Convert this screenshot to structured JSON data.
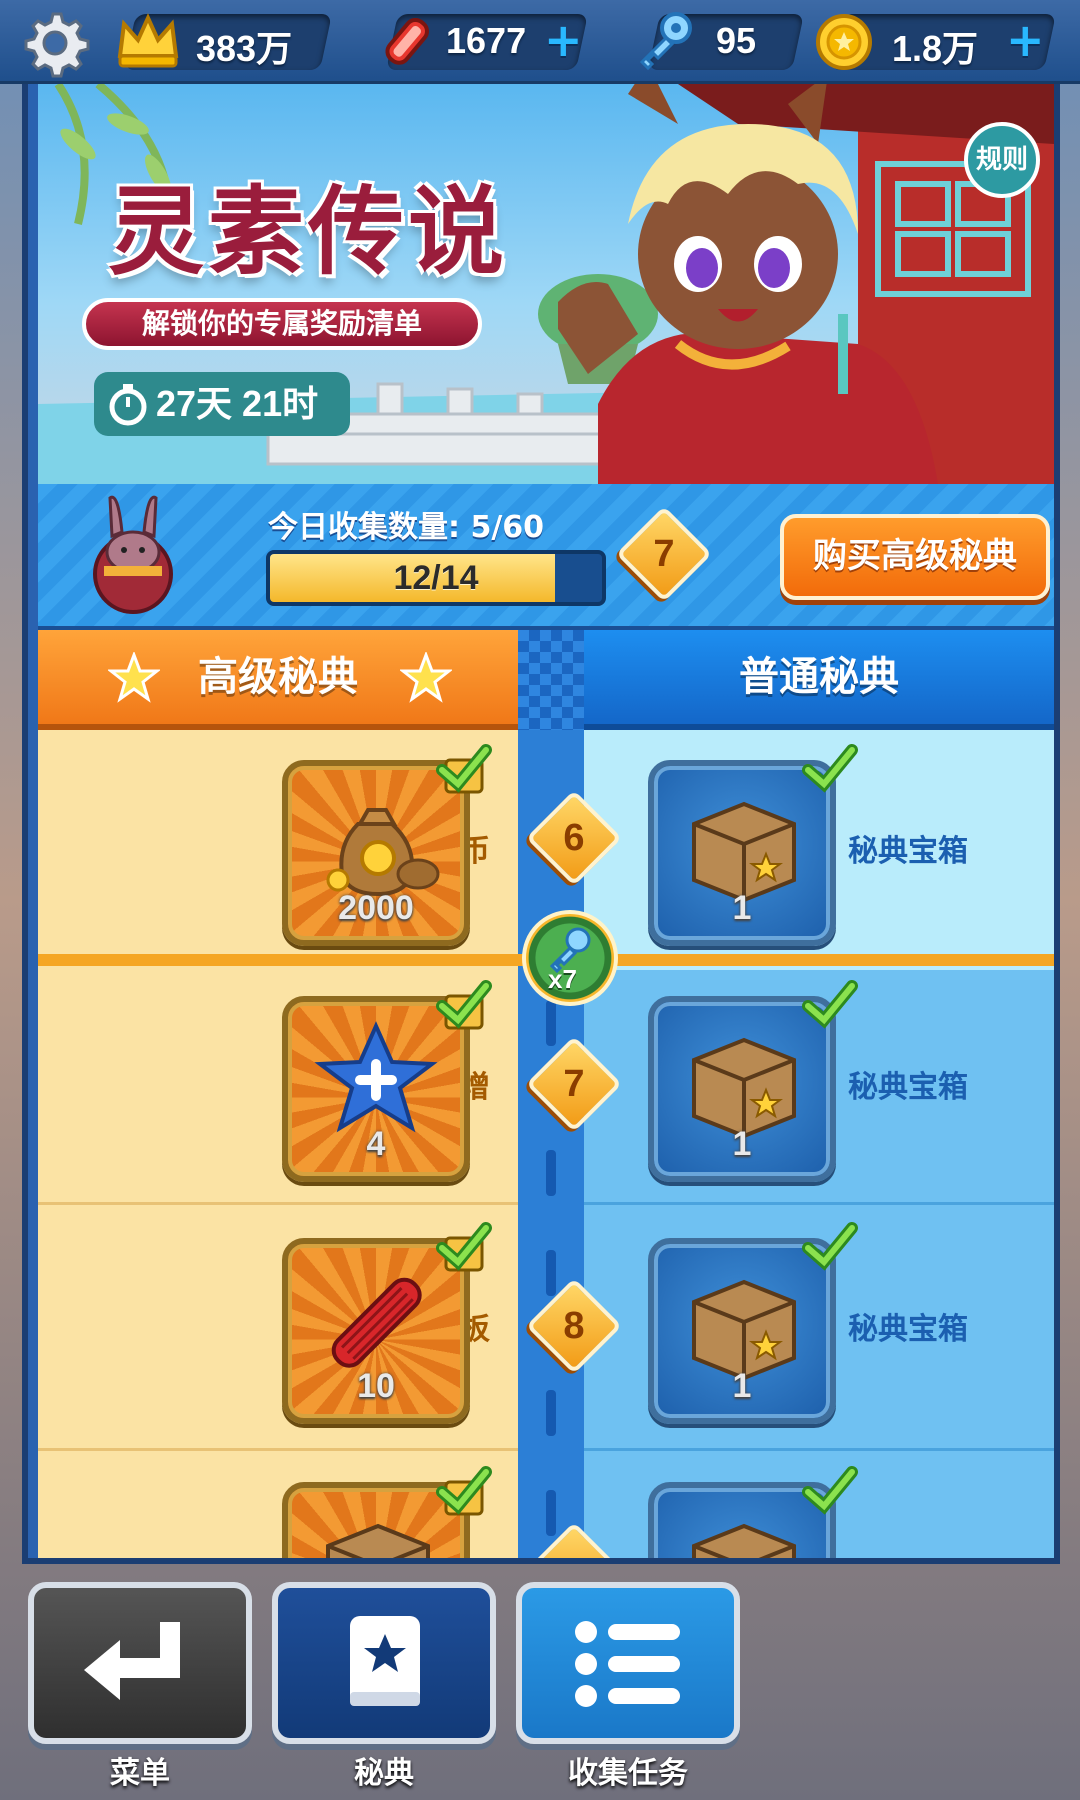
{
  "topbar": {
    "icons": [
      "gear-icon",
      "crown-icon",
      "hoverboard-icon",
      "key-icon",
      "coin-icon",
      "plus-icon"
    ],
    "crown_value": "383万",
    "hoverboard_value": "1677",
    "key_value": "95",
    "coin_value": "1.8万"
  },
  "banner": {
    "title": "灵素传说",
    "subtitle": "解锁你的专属奖励清单",
    "timer": "27天 21时",
    "rules_label": "规则"
  },
  "progress": {
    "today_label": "今日收集数量: 5/60",
    "bar_text": "12/14",
    "bar_fraction": 0.857,
    "level": "7",
    "buy_button": "购买高级秘典"
  },
  "tabs": {
    "premium": "高级秘典",
    "normal": "普通秘典"
  },
  "rewards": [
    {
      "level": "6",
      "premium_label": "金币",
      "premium_icon": "coin-bag-icon",
      "premium_qty": "2000",
      "normal_label": "秘典宝箱",
      "normal_qty": "1"
    },
    {
      "level": "7",
      "premium_label": "得分倍增",
      "premium_icon": "score-star-icon",
      "premium_qty": "4",
      "normal_label": "秘典宝箱",
      "normal_qty": "1"
    },
    {
      "level": "8",
      "premium_label": "滑板",
      "premium_icon": "hoverboard-icon",
      "premium_qty": "10",
      "normal_label": "秘典宝箱",
      "normal_qty": "1"
    }
  ],
  "milestone": {
    "key_qty": "x7"
  },
  "nav": {
    "menu": "菜单",
    "book": "秘典",
    "tasks": "收集任务"
  },
  "colors": {
    "premium_tab": "#f07818",
    "normal_tab": "#1467c9",
    "buy_button": "#f26b0a",
    "progress_fill": "#f4b82b"
  }
}
